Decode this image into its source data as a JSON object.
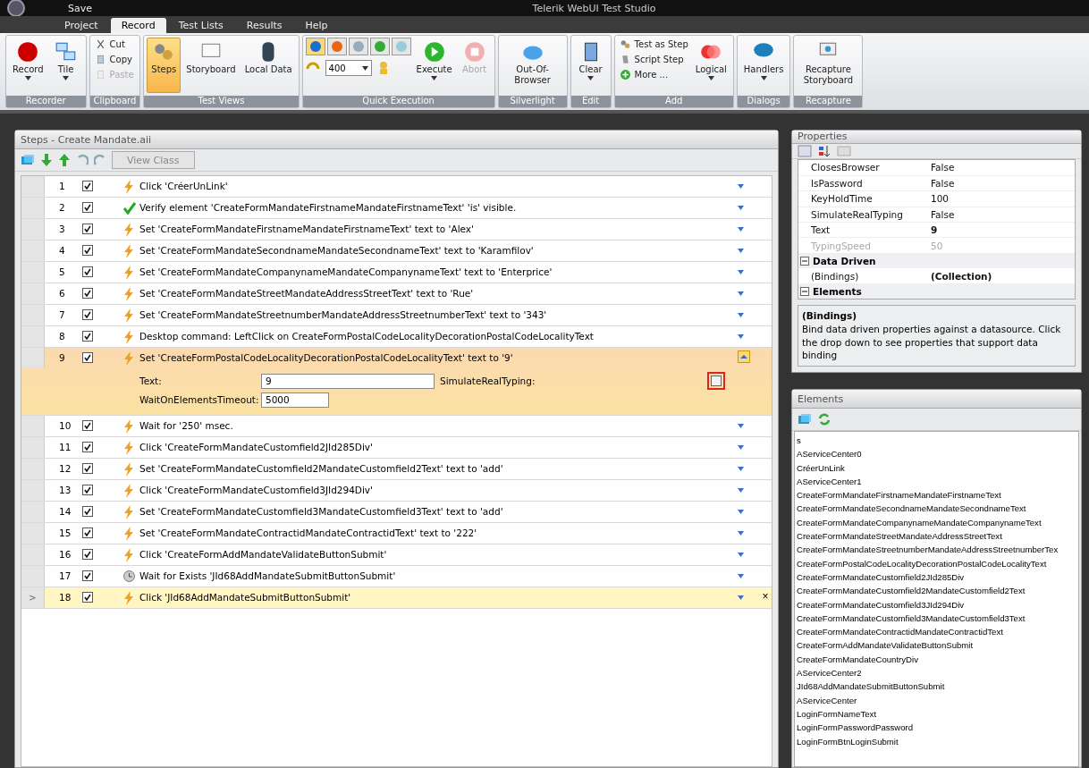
{
  "window": {
    "title": "Telerik WebUI Test Studio",
    "quick_access": "Save"
  },
  "menu_tabs": [
    {
      "label": "Project",
      "selected": false
    },
    {
      "label": "Record",
      "selected": true
    },
    {
      "label": "Test Lists",
      "selected": false
    },
    {
      "label": "Results",
      "selected": false
    },
    {
      "label": "Help",
      "selected": false
    }
  ],
  "ribbon": [
    {
      "group": "Recorder",
      "items": [
        {
          "kind": "large",
          "label": "Record",
          "dropdown": true,
          "disabled": false,
          "selected": false
        },
        {
          "kind": "large",
          "label": "Tile",
          "dropdown": true,
          "disabled": false,
          "selected": false
        }
      ]
    },
    {
      "group": "Clipboard",
      "items": [
        {
          "kind": "small",
          "label": "Cut",
          "disabled": false
        },
        {
          "kind": "small",
          "label": "Copy",
          "disabled": false
        },
        {
          "kind": "small",
          "label": "Paste",
          "disabled": true
        }
      ]
    },
    {
      "group": "Test Views",
      "items": [
        {
          "kind": "large",
          "label": "Steps",
          "dropdown": false,
          "disabled": false,
          "selected": true
        },
        {
          "kind": "large",
          "label": "Storyboard",
          "dropdown": false,
          "disabled": false,
          "selected": false
        },
        {
          "kind": "large",
          "label": "Local Data",
          "dropdown": false,
          "disabled": false,
          "selected": false
        }
      ]
    },
    {
      "group": "Quick Execution",
      "items": [
        {
          "kind": "browsers",
          "speed": "400"
        },
        {
          "kind": "large",
          "label": "Execute",
          "dropdown": true,
          "disabled": false,
          "selected": false
        },
        {
          "kind": "large",
          "label": "Abort",
          "dropdown": false,
          "disabled": true,
          "selected": false
        }
      ]
    },
    {
      "group": "Silverlight",
      "items": [
        {
          "kind": "large",
          "label": "Out-Of-Browser",
          "dropdown": false,
          "disabled": false,
          "selected": false
        }
      ]
    },
    {
      "group": "Edit",
      "items": [
        {
          "kind": "large",
          "label": "Clear",
          "dropdown": true,
          "disabled": false,
          "selected": false
        }
      ]
    },
    {
      "group": "Add",
      "items": [
        {
          "kind": "small",
          "label": "Test as Step",
          "disabled": false
        },
        {
          "kind": "small",
          "label": "Script Step",
          "disabled": false
        },
        {
          "kind": "small",
          "label": "More ...",
          "disabled": false
        },
        {
          "kind": "large",
          "label": "Logical",
          "dropdown": true,
          "disabled": false,
          "selected": false
        }
      ]
    },
    {
      "group": "Dialogs",
      "items": [
        {
          "kind": "large",
          "label": "Handlers",
          "dropdown": true,
          "disabled": false,
          "selected": false
        }
      ]
    },
    {
      "group": "Recapture",
      "items": [
        {
          "kind": "large",
          "label": "Recapture Storyboard",
          "dropdown": false,
          "disabled": false,
          "selected": false
        }
      ]
    }
  ],
  "steps_panel": {
    "title": "Steps - Create Mandate.aii",
    "view_class_button": "View Class",
    "steps": [
      {
        "number": "1",
        "checked": true,
        "kind": "action",
        "text": "Click 'CréerUnLink'",
        "selected": false
      },
      {
        "number": "2",
        "checked": true,
        "kind": "verify",
        "text": "Verify element 'CreateFormMandateFirstnameMandateFirstnameText' 'is' visible.",
        "selected": false
      },
      {
        "number": "3",
        "checked": true,
        "kind": "action",
        "text": "Set 'CreateFormMandateFirstnameMandateFirstnameText' text to 'Alex'",
        "selected": false
      },
      {
        "number": "4",
        "checked": true,
        "kind": "action",
        "text": "Set 'CreateFormMandateSecondnameMandateSecondnameText' text to 'Karamfilov'",
        "selected": false
      },
      {
        "number": "5",
        "checked": true,
        "kind": "action",
        "text": "Set 'CreateFormMandateCompanynameMandateCompanynameText' text to 'Enterprice'",
        "selected": false
      },
      {
        "number": "6",
        "checked": true,
        "kind": "action",
        "text": "Set 'CreateFormMandateStreetMandateAddressStreetText' text to 'Rue'",
        "selected": false
      },
      {
        "number": "7",
        "checked": true,
        "kind": "action",
        "text": "Set 'CreateFormMandateStreetnumberMandateAddressStreetnumberText' text to '343'",
        "selected": false
      },
      {
        "number": "8",
        "checked": true,
        "kind": "action",
        "text": "Desktop command: LeftClick on CreateFormPostalCodeLocalityDecorationPostalCodeLocalityText",
        "selected": false
      },
      {
        "number": "9",
        "checked": true,
        "kind": "action",
        "text": "Set 'CreateFormPostalCodeLocalityDecorationPostalCodeLocalityText' text to '9'",
        "selected": false,
        "expanded": true,
        "fields": {
          "text_label": "Text:",
          "text_value": "9",
          "simulate_label": "SimulateRealTyping:",
          "simulate_checked": false,
          "timeout_label": "WaitOnElementsTimeout:",
          "timeout_value": "5000"
        }
      },
      {
        "number": "10",
        "checked": true,
        "kind": "action",
        "text": "Wait for '250' msec.",
        "selected": false
      },
      {
        "number": "11",
        "checked": true,
        "kind": "action",
        "text": "Click 'CreateFormMandateCustomfield2JId285Div'",
        "selected": false
      },
      {
        "number": "12",
        "checked": true,
        "kind": "action",
        "text": "Set 'CreateFormMandateCustomfield2MandateCustomfield2Text' text to 'add'",
        "selected": false
      },
      {
        "number": "13",
        "checked": true,
        "kind": "action",
        "text": "Click 'CreateFormMandateCustomfield3JId294Div'",
        "selected": false
      },
      {
        "number": "14",
        "checked": true,
        "kind": "action",
        "text": "Set 'CreateFormMandateCustomfield3MandateCustomfield3Text' text to 'add'",
        "selected": false
      },
      {
        "number": "15",
        "checked": true,
        "kind": "action",
        "text": "Set 'CreateFormMandateContractidMandateContractidText' text to '222'",
        "selected": false
      },
      {
        "number": "16",
        "checked": true,
        "kind": "action",
        "text": "Click 'CreateFormAddMandateValidateButtonSubmit'",
        "selected": false
      },
      {
        "number": "17",
        "checked": true,
        "kind": "wait",
        "text": "Wait for Exists 'JId68AddMandateSubmitButtonSubmit'",
        "selected": false
      },
      {
        "number": "18",
        "checked": true,
        "kind": "action",
        "text": "Click 'JId68AddMandateSubmitButtonSubmit'",
        "selected": true,
        "row_marker": ">",
        "delete": "×"
      }
    ]
  },
  "properties_panel": {
    "title": "Properties",
    "rows": [
      {
        "kind": "prop",
        "name": "ClosesBrowser",
        "value": "False",
        "disabled": false,
        "modified": false
      },
      {
        "kind": "prop",
        "name": "IsPassword",
        "value": "False",
        "disabled": false,
        "modified": false
      },
      {
        "kind": "prop",
        "name": "KeyHoldTime",
        "value": "100",
        "disabled": false,
        "modified": false
      },
      {
        "kind": "prop",
        "name": "SimulateRealTyping",
        "value": "False",
        "disabled": false,
        "modified": false
      },
      {
        "kind": "prop",
        "name": "Text",
        "value": "9",
        "disabled": false,
        "modified": true
      },
      {
        "kind": "prop",
        "name": "TypingSpeed",
        "value": "50",
        "disabled": true,
        "modified": false
      },
      {
        "kind": "category",
        "name": "Data Driven",
        "expanded": true
      },
      {
        "kind": "prop",
        "name": "(Bindings)",
        "value": "(Collection)",
        "disabled": false,
        "modified": true
      },
      {
        "kind": "category",
        "name": "Elements",
        "expanded": true
      }
    ],
    "description_title": "(Bindings)",
    "description": "Bind data driven properties against a datasource. Click the drop down to see properties that support data binding"
  },
  "elements_panel": {
    "title": "Elements",
    "items": [
      "s",
      "AServiceCenter0",
      "CréerUnLink",
      "AServiceCenter1",
      "CreateFormMandateFirstnameMandateFirstnameText",
      "CreateFormMandateSecondnameMandateSecondnameText",
      "CreateFormMandateCompanynameMandateCompanynameText",
      "CreateFormMandateStreetMandateAddressStreetText",
      "CreateFormMandateStreetnumberMandateAddressStreetnumberTex",
      "CreateFormPostalCodeLocalityDecorationPostalCodeLocalityText",
      "CreateFormMandateCustomfield2JId285Div",
      "CreateFormMandateCustomfield2MandateCustomfield2Text",
      "CreateFormMandateCustomfield3JId294Div",
      "CreateFormMandateCustomfield3MandateCustomfield3Text",
      "CreateFormMandateContractidMandateContractidText",
      "CreateFormAddMandateValidateButtonSubmit",
      "CreateFormMandateCountryDiv",
      "AServiceCenter2",
      "JId68AddMandateSubmitButtonSubmit",
      "AServiceCenter",
      "LoginFormNameText",
      "LoginFormPasswordPassword",
      "LoginFormBtnLoginSubmit"
    ]
  }
}
